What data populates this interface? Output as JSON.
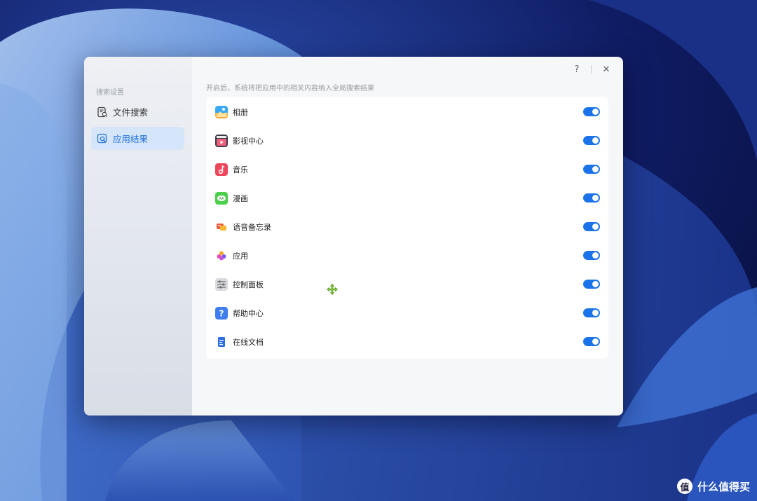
{
  "window": {
    "help_label": "?",
    "close_label": "✕"
  },
  "sidebar": {
    "heading": "搜索设置",
    "items": [
      {
        "label": "文件搜索",
        "icon": "file-search-icon",
        "active": false
      },
      {
        "label": "应用结果",
        "icon": "app-search-icon",
        "active": true
      }
    ]
  },
  "main": {
    "description": "开启后，系统将把应用中的相关内容纳入全局搜索结果",
    "apps": [
      {
        "label": "相册",
        "icon": "photos-icon",
        "enabled": true
      },
      {
        "label": "影视中心",
        "icon": "video-center-icon",
        "enabled": true
      },
      {
        "label": "音乐",
        "icon": "music-icon",
        "enabled": true
      },
      {
        "label": "漫画",
        "icon": "comics-icon",
        "enabled": true
      },
      {
        "label": "语音备忘录",
        "icon": "voice-memo-icon",
        "enabled": true
      },
      {
        "label": "应用",
        "icon": "apps-icon",
        "enabled": true
      },
      {
        "label": "控制面板",
        "icon": "control-panel-icon",
        "enabled": true
      },
      {
        "label": "帮助中心",
        "icon": "help-center-icon",
        "enabled": true
      },
      {
        "label": "在线文档",
        "icon": "online-docs-icon",
        "enabled": true
      }
    ]
  },
  "watermark": {
    "badge": "值",
    "text": "什么值得买"
  },
  "colors": {
    "accent": "#1a73e8",
    "active_nav_bg": "#d6e6fa",
    "active_nav_text": "#1e6fd9"
  }
}
